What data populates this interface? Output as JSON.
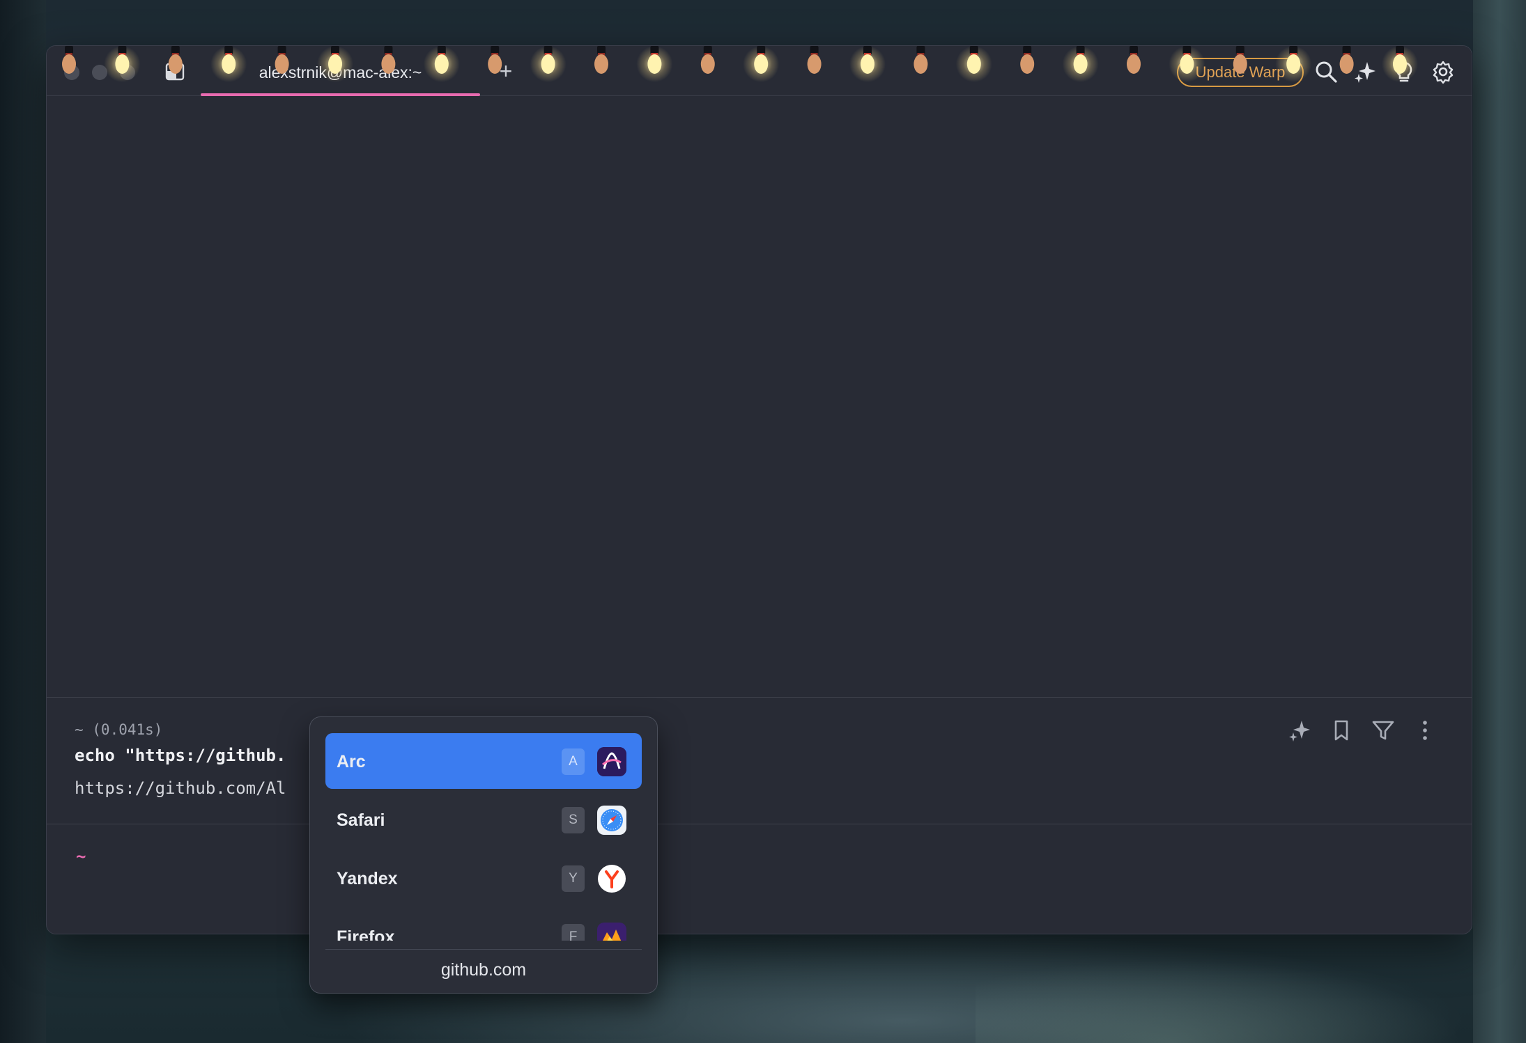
{
  "window": {
    "tab_title": "alexstrnik@mac-alex:~",
    "new_tab_label": "+",
    "update_button": "Update Warp"
  },
  "titlebar_icons": [
    "panel-icon",
    "search-icon",
    "ai-sparkle-icon",
    "lightbulb-icon",
    "settings-gear-icon"
  ],
  "block": {
    "meta": "~ (0.041s)",
    "command": "echo \"https://github.",
    "output": "https://github.com/Al",
    "actions": [
      "ai-sparkle-icon",
      "bookmark-icon",
      "filter-icon",
      "more-vertical-icon"
    ]
  },
  "prompt": {
    "symbol": "~"
  },
  "browser_picker": {
    "items": [
      {
        "name": "Arc",
        "key": "A",
        "icon": "arc-icon",
        "selected": true
      },
      {
        "name": "Safari",
        "key": "S",
        "icon": "safari-icon",
        "selected": false
      },
      {
        "name": "Yandex",
        "key": "Y",
        "icon": "yandex-icon",
        "selected": false
      },
      {
        "name": "Firefox",
        "key": "F",
        "icon": "firefox-icon",
        "selected": false
      }
    ],
    "domain": "github.com"
  },
  "colors": {
    "window_bg": "#282b35",
    "accent_pink": "#e86bb0",
    "selection_blue": "#3b7cf0",
    "update_orange": "#d79a43"
  }
}
